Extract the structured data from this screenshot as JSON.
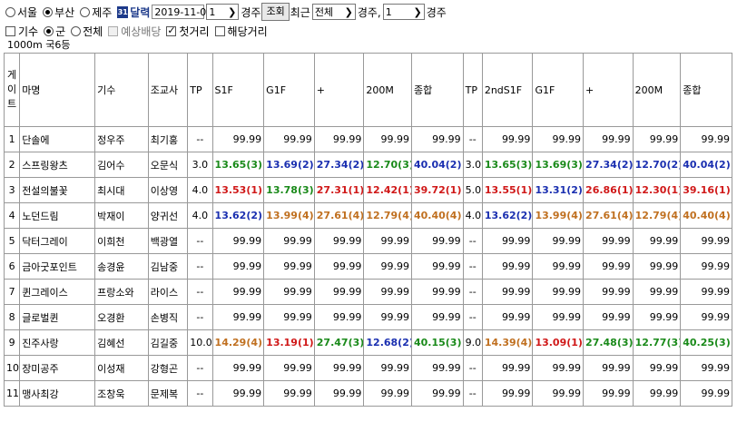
{
  "toolbar": {
    "regions": [
      {
        "label": "서울",
        "selected": false
      },
      {
        "label": "부산",
        "selected": true
      },
      {
        "label": "제주",
        "selected": false
      }
    ],
    "calendar_label": "31",
    "date_mode": "달력",
    "date_value": "2019-11-01",
    "race_no": "1",
    "race_suffix": "경주",
    "search_button": "조회",
    "recent_label": "최근",
    "recent_value": "전체",
    "recent_suffix": "경주,",
    "race_count": "1",
    "race_count_suffix": "경주"
  },
  "options": {
    "items": [
      {
        "type": "checkbox",
        "label": "기수",
        "checked": false,
        "disabled": false
      },
      {
        "type": "radio",
        "label": "군",
        "checked": true
      },
      {
        "type": "radio",
        "label": "전체",
        "checked": false
      },
      {
        "type": "checkbox",
        "label": "예상배당",
        "checked": false,
        "disabled": true
      },
      {
        "type": "checkbox",
        "label": "첫거리",
        "checked": true,
        "disabled": false
      },
      {
        "type": "checkbox",
        "label": "해당거리",
        "checked": false,
        "disabled": false
      }
    ]
  },
  "race_info": "1000m   국6등",
  "table": {
    "headers": [
      "게\n이\n트",
      "마명",
      "기수",
      "조교사",
      "TP",
      "S1F",
      "G1F",
      "+",
      "200M",
      "종합",
      "TP",
      "2ndS1F",
      "G1F",
      "+",
      "200M",
      "종합"
    ],
    "rows": [
      {
        "gate": "1",
        "horse": "단솔에",
        "jockey": "정우주",
        "trainer": "최기홍",
        "tp1": "--",
        "s1f": [
          "99.99",
          "p"
        ],
        "g1f": [
          "99.99",
          "p"
        ],
        "plus1": [
          "99.99",
          "p"
        ],
        "m200": [
          "99.99",
          "p"
        ],
        "total1": [
          "99.99",
          "p"
        ],
        "tp2": "--",
        "s1f2": [
          "99.99",
          "p"
        ],
        "g1f2": [
          "99.99",
          "p"
        ],
        "plus2": [
          "99.99",
          "p"
        ],
        "m2002": [
          "99.99",
          "p"
        ],
        "total2": [
          "99.99",
          "p"
        ]
      },
      {
        "gate": "2",
        "horse": "스프링왕츠",
        "jockey": "김어수",
        "trainer": "오문식",
        "tp1": "3.0",
        "s1f": [
          "13.65(3)",
          "g"
        ],
        "g1f": [
          "13.69(2)",
          "b"
        ],
        "plus1": [
          "27.34(2)",
          "b"
        ],
        "m200": [
          "12.70(3)",
          "g"
        ],
        "total1": [
          "40.04(2)",
          "b"
        ],
        "tp2": "3.0",
        "s1f2": [
          "13.65(3)",
          "g"
        ],
        "g1f2": [
          "13.69(3)",
          "g"
        ],
        "plus2": [
          "27.34(2)",
          "b"
        ],
        "m2002": [
          "12.70(2)",
          "b"
        ],
        "total2": [
          "40.04(2)",
          "b"
        ]
      },
      {
        "gate": "3",
        "horse": "전설의불꽃",
        "jockey": "최시대",
        "trainer": "이상영",
        "tp1": "4.0",
        "s1f": [
          "13.53(1)",
          "r"
        ],
        "g1f": [
          "13.78(3)",
          "g"
        ],
        "plus1": [
          "27.31(1)",
          "r"
        ],
        "m200": [
          "12.42(1)",
          "r"
        ],
        "total1": [
          "39.72(1)",
          "r"
        ],
        "tp2": "5.0",
        "s1f2": [
          "13.55(1)",
          "r"
        ],
        "g1f2": [
          "13.31(2)",
          "b"
        ],
        "plus2": [
          "26.86(1)",
          "r"
        ],
        "m2002": [
          "12.30(1)",
          "r"
        ],
        "total2": [
          "39.16(1)",
          "r"
        ]
      },
      {
        "gate": "4",
        "horse": "노던드림",
        "jockey": "박재이",
        "trainer": "양귀선",
        "tp1": "4.0",
        "s1f": [
          "13.62(2)",
          "b"
        ],
        "g1f": [
          "13.99(4)",
          "o"
        ],
        "plus1": [
          "27.61(4)",
          "o"
        ],
        "m200": [
          "12.79(4)",
          "o"
        ],
        "total1": [
          "40.40(4)",
          "o"
        ],
        "tp2": "4.0",
        "s1f2": [
          "13.62(2)",
          "b"
        ],
        "g1f2": [
          "13.99(4)",
          "o"
        ],
        "plus2": [
          "27.61(4)",
          "o"
        ],
        "m2002": [
          "12.79(4)",
          "o"
        ],
        "total2": [
          "40.40(4)",
          "o"
        ]
      },
      {
        "gate": "5",
        "horse": "닥터그레이",
        "jockey": "이희천",
        "trainer": "백광열",
        "tp1": "--",
        "s1f": [
          "99.99",
          "p"
        ],
        "g1f": [
          "99.99",
          "p"
        ],
        "plus1": [
          "99.99",
          "p"
        ],
        "m200": [
          "99.99",
          "p"
        ],
        "total1": [
          "99.99",
          "p"
        ],
        "tp2": "--",
        "s1f2": [
          "99.99",
          "p"
        ],
        "g1f2": [
          "99.99",
          "p"
        ],
        "plus2": [
          "99.99",
          "p"
        ],
        "m2002": [
          "99.99",
          "p"
        ],
        "total2": [
          "99.99",
          "p"
        ]
      },
      {
        "gate": "6",
        "horse": "금아굿포인트",
        "jockey": "송경윤",
        "trainer": "김남중",
        "tp1": "--",
        "s1f": [
          "99.99",
          "p"
        ],
        "g1f": [
          "99.99",
          "p"
        ],
        "plus1": [
          "99.99",
          "p"
        ],
        "m200": [
          "99.99",
          "p"
        ],
        "total1": [
          "99.99",
          "p"
        ],
        "tp2": "--",
        "s1f2": [
          "99.99",
          "p"
        ],
        "g1f2": [
          "99.99",
          "p"
        ],
        "plus2": [
          "99.99",
          "p"
        ],
        "m2002": [
          "99.99",
          "p"
        ],
        "total2": [
          "99.99",
          "p"
        ]
      },
      {
        "gate": "7",
        "horse": "퀸그레이스",
        "jockey": "프랑소와",
        "trainer": "라이스",
        "tp1": "--",
        "s1f": [
          "99.99",
          "p"
        ],
        "g1f": [
          "99.99",
          "p"
        ],
        "plus1": [
          "99.99",
          "p"
        ],
        "m200": [
          "99.99",
          "p"
        ],
        "total1": [
          "99.99",
          "p"
        ],
        "tp2": "--",
        "s1f2": [
          "99.99",
          "p"
        ],
        "g1f2": [
          "99.99",
          "p"
        ],
        "plus2": [
          "99.99",
          "p"
        ],
        "m2002": [
          "99.99",
          "p"
        ],
        "total2": [
          "99.99",
          "p"
        ]
      },
      {
        "gate": "8",
        "horse": "글로벌퀸",
        "jockey": "오경환",
        "trainer": "손병직",
        "tp1": "--",
        "s1f": [
          "99.99",
          "p"
        ],
        "g1f": [
          "99.99",
          "p"
        ],
        "plus1": [
          "99.99",
          "p"
        ],
        "m200": [
          "99.99",
          "p"
        ],
        "total1": [
          "99.99",
          "p"
        ],
        "tp2": "--",
        "s1f2": [
          "99.99",
          "p"
        ],
        "g1f2": [
          "99.99",
          "p"
        ],
        "plus2": [
          "99.99",
          "p"
        ],
        "m2002": [
          "99.99",
          "p"
        ],
        "total2": [
          "99.99",
          "p"
        ]
      },
      {
        "gate": "9",
        "horse": "진주사랑",
        "jockey": "김혜선",
        "trainer": "김길중",
        "tp1": "10.0",
        "s1f": [
          "14.29(4)",
          "o"
        ],
        "g1f": [
          "13.19(1)",
          "r"
        ],
        "plus1": [
          "27.47(3)",
          "g"
        ],
        "m200": [
          "12.68(2)",
          "b"
        ],
        "total1": [
          "40.15(3)",
          "g"
        ],
        "tp2": "9.0",
        "s1f2": [
          "14.39(4)",
          "o"
        ],
        "g1f2": [
          "13.09(1)",
          "r"
        ],
        "plus2": [
          "27.48(3)",
          "g"
        ],
        "m2002": [
          "12.77(3)",
          "g"
        ],
        "total2": [
          "40.25(3)",
          "g"
        ]
      },
      {
        "gate": "10",
        "horse": "장미공주",
        "jockey": "이성재",
        "trainer": "강형곤",
        "tp1": "--",
        "s1f": [
          "99.99",
          "p"
        ],
        "g1f": [
          "99.99",
          "p"
        ],
        "plus1": [
          "99.99",
          "p"
        ],
        "m200": [
          "99.99",
          "p"
        ],
        "total1": [
          "99.99",
          "p"
        ],
        "tp2": "--",
        "s1f2": [
          "99.99",
          "p"
        ],
        "g1f2": [
          "99.99",
          "p"
        ],
        "plus2": [
          "99.99",
          "p"
        ],
        "m2002": [
          "99.99",
          "p"
        ],
        "total2": [
          "99.99",
          "p"
        ]
      },
      {
        "gate": "11",
        "horse": "맹사최강",
        "jockey": "조창욱",
        "trainer": "문제복",
        "tp1": "--",
        "s1f": [
          "99.99",
          "p"
        ],
        "g1f": [
          "99.99",
          "p"
        ],
        "plus1": [
          "99.99",
          "p"
        ],
        "m200": [
          "99.99",
          "p"
        ],
        "total1": [
          "99.99",
          "p"
        ],
        "tp2": "--",
        "s1f2": [
          "99.99",
          "p"
        ],
        "g1f2": [
          "99.99",
          "p"
        ],
        "plus2": [
          "99.99",
          "p"
        ],
        "m2002": [
          "99.99",
          "p"
        ],
        "total2": [
          "99.99",
          "p"
        ]
      }
    ]
  },
  "colors": {
    "g": "#1a8a1a",
    "b": "#1a2fb0",
    "r": "#d01818",
    "o": "#c07020",
    "p": "#000000"
  }
}
